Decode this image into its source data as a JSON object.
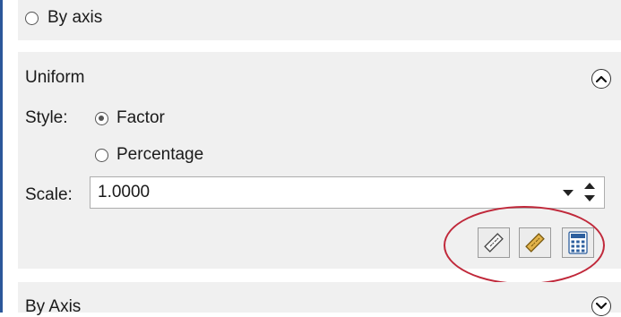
{
  "by_axis_option": {
    "label": "By axis"
  },
  "uniform_panel": {
    "title": "Uniform",
    "style_label": "Style:",
    "style_options": [
      {
        "label": "Factor",
        "selected": true
      },
      {
        "label": "Percentage",
        "selected": false
      }
    ],
    "scale_label": "Scale:",
    "scale_value": "1.0000",
    "tools": [
      {
        "icon": "ruler-measure-icon"
      },
      {
        "icon": "ruler-yellow-icon"
      },
      {
        "icon": "calculator-icon"
      }
    ]
  },
  "by_axis_panel": {
    "title": "By Axis"
  },
  "colors": {
    "accent": "#2b579a",
    "highlight": "#c0283a",
    "panel_bg": "#f0f0f0"
  }
}
